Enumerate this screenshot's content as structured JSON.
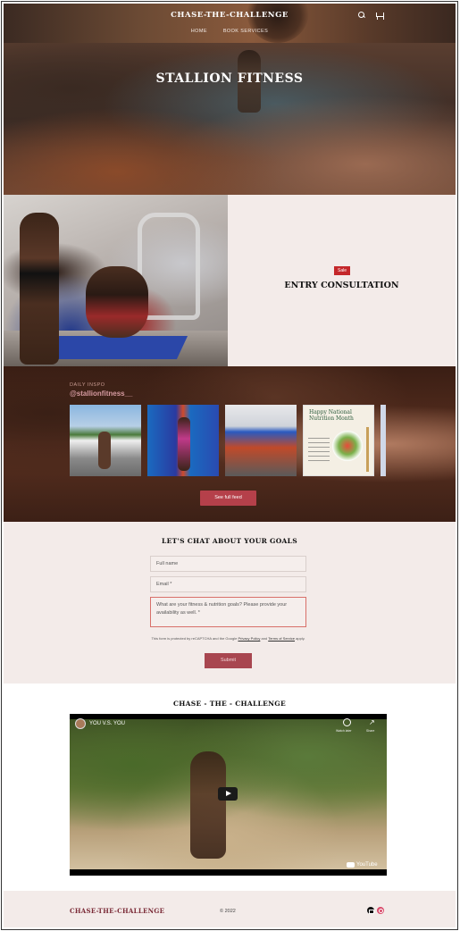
{
  "header": {
    "brand": "CHASE-THE-CHALLENGE",
    "nav": [
      "HOME",
      "BOOK SERVICES"
    ]
  },
  "hero": {
    "title": "STALLION FITNESS"
  },
  "consultation": {
    "badge": "Sale",
    "title": "ENTRY CONSULTATION"
  },
  "feed": {
    "label": "DAILY INSPO",
    "handle": "@stallionfitness__",
    "nutrition_post_title": "Happy National Nutrition Month",
    "button": "See full feed"
  },
  "contact": {
    "title": "LET'S CHAT ABOUT YOUR GOALS",
    "full_name_placeholder": "Full name",
    "email_placeholder": "Email *",
    "message_placeholder": "What are your fitness & nutrition goals? Please provide your availability as well. *",
    "recaptcha_text": "This form is protected by reCAPTCHA and the Google",
    "privacy_link": "Privacy Policy",
    "and_text": "and",
    "terms_link": "Terms of Service",
    "apply_text": "apply.",
    "submit": "Submit"
  },
  "video": {
    "section_title": "CHASE - THE - CHALLENGE",
    "video_title": "YOU V.S. YOU",
    "watch_later": "Watch later",
    "share": "Share",
    "youtube": "YouTube"
  },
  "footer": {
    "brand": "CHASE-THE-CHALLENGE",
    "copyright": "© 2022"
  },
  "colors": {
    "accent": "#b5404a",
    "sale": "#c4272a",
    "section_bg": "#f3ebe9",
    "footer_brand": "#7a2a36"
  }
}
